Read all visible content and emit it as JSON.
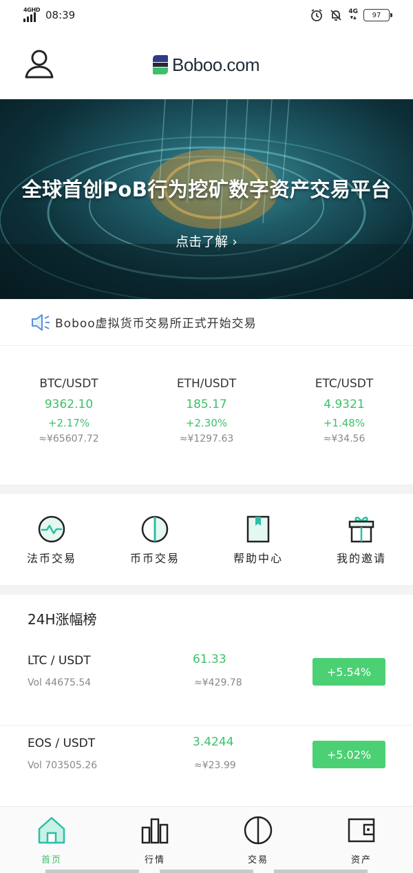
{
  "status_bar": {
    "network_left": "4GHD",
    "time": "08:39",
    "network_right": "4G",
    "battery": "97"
  },
  "header": {
    "logo_text": "Boboo.com",
    "user_icon": "user-icon"
  },
  "banner": {
    "title": "全球首创PoB行为挖矿数字资产交易平台",
    "link_label": "点击了解 ›"
  },
  "notice": {
    "icon": "speaker-icon",
    "text": "Boboo虚拟货币交易所正式开始交易"
  },
  "tickers": [
    {
      "pair": "BTC/USDT",
      "price": "9362.10",
      "change": "+2.17%",
      "cny": "≈¥65607.72"
    },
    {
      "pair": "ETH/USDT",
      "price": "185.17",
      "change": "+2.30%",
      "cny": "≈¥1297.63"
    },
    {
      "pair": "ETC/USDT",
      "price": "4.9321",
      "change": "+1.48%",
      "cny": "≈¥34.56"
    }
  ],
  "quick_menu": [
    {
      "label": "法币交易",
      "icon": "fiat-trade-icon"
    },
    {
      "label": "币币交易",
      "icon": "coin-trade-icon"
    },
    {
      "label": "帮助中心",
      "icon": "help-book-icon"
    },
    {
      "label": "我的邀请",
      "icon": "gift-icon"
    }
  ],
  "ranking": {
    "title": "24H涨幅榜",
    "rows": [
      {
        "pair": "LTC / USDT",
        "volume": "Vol 44675.54",
        "price": "61.33",
        "cny": "≈¥429.78",
        "change": "+5.54%"
      },
      {
        "pair": "EOS / USDT",
        "volume": "Vol 703505.26",
        "price": "3.4244",
        "cny": "≈¥23.99",
        "change": "+5.02%"
      }
    ]
  },
  "tabbar": [
    {
      "label": "首页",
      "icon": "home-icon",
      "active": true
    },
    {
      "label": "行情",
      "icon": "market-chart-icon",
      "active": false
    },
    {
      "label": "交易",
      "icon": "trade-icon",
      "active": false
    },
    {
      "label": "资产",
      "icon": "wallet-icon",
      "active": false
    }
  ],
  "colors": {
    "accent_green": "#3cc06a",
    "badge_green": "#4cd074",
    "icon_teal": "#2bbfa5",
    "text_dark": "#222222",
    "text_gray": "#888888"
  }
}
